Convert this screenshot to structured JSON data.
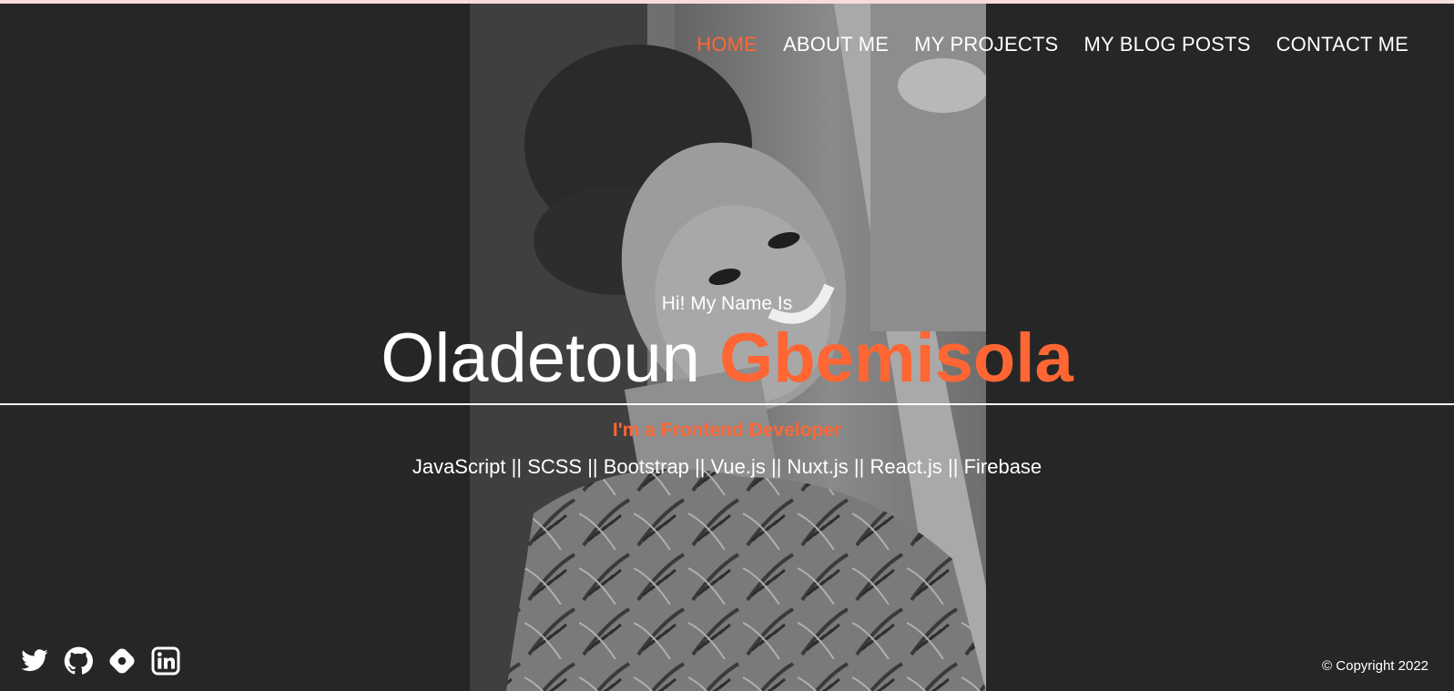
{
  "nav": {
    "items": [
      {
        "label": "HOME",
        "active": true
      },
      {
        "label": "ABOUT ME",
        "active": false
      },
      {
        "label": "MY PROJECTS",
        "active": false
      },
      {
        "label": "MY BLOG POSTS",
        "active": false
      },
      {
        "label": "CONTACT ME",
        "active": false
      }
    ]
  },
  "hero": {
    "greeting": "Hi! My Name Is",
    "first_name": "Oladetoun",
    "last_name": "Gbemisola",
    "role": "I'm a Frontend Developer",
    "skills": "JavaScript || SCSS || Bootstrap || Vue.js || Nuxt.js || React.js || Firebase"
  },
  "social": [
    {
      "icon": "twitter-icon"
    },
    {
      "icon": "github-icon"
    },
    {
      "icon": "hashnode-icon"
    },
    {
      "icon": "linkedin-icon"
    }
  ],
  "footer": {
    "copyright": "© Copyright 2022"
  },
  "colors": {
    "background": "#262626",
    "accent": "#ff6633",
    "text": "#ffffff"
  }
}
